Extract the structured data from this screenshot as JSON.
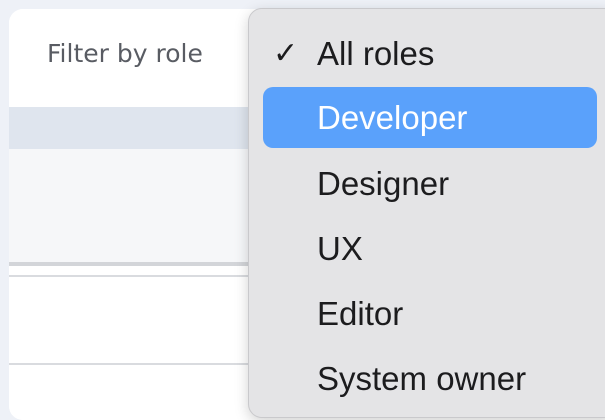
{
  "filter": {
    "label": "Filter by role"
  },
  "role_menu": {
    "selected": "All roles",
    "highlighted": "Developer",
    "items": [
      {
        "label": "All roles",
        "checked": true
      },
      {
        "label": "Developer",
        "checked": false
      },
      {
        "label": "Designer",
        "checked": false
      },
      {
        "label": "UX",
        "checked": false
      },
      {
        "label": "Editor",
        "checked": false
      },
      {
        "label": "System owner",
        "checked": false
      }
    ],
    "check_glyph": "✓",
    "highlight_color": "#5aa1fb"
  }
}
